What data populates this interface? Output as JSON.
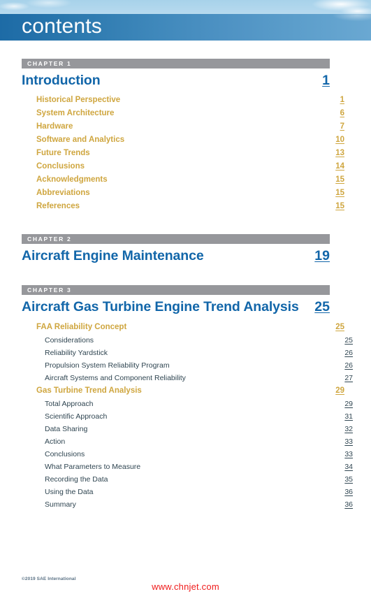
{
  "header": {
    "title": "contents",
    "banner_color": "#1d6ba6",
    "sky_color": "#bcdcf0"
  },
  "colors": {
    "chapter_title": "#1266a9",
    "chapter_bar": "#96979b",
    "level2": "#cfa63f",
    "level3": "#2f4551",
    "watermark": "#f01c1c"
  },
  "chapters": [
    {
      "bar_label": "CHAPTER 1",
      "title": "Introduction",
      "page": "1",
      "entries": [
        {
          "level": 2,
          "label": "Historical Perspective",
          "page": "1"
        },
        {
          "level": 2,
          "label": "System Architecture",
          "page": "6"
        },
        {
          "level": 2,
          "label": "Hardware",
          "page": "7"
        },
        {
          "level": 2,
          "label": "Software and Analytics",
          "page": "10"
        },
        {
          "level": 2,
          "label": "Future Trends",
          "page": "13"
        },
        {
          "level": 2,
          "label": "Conclusions",
          "page": "14"
        },
        {
          "level": 2,
          "label": "Acknowledgments",
          "page": "15"
        },
        {
          "level": 2,
          "label": "Abbreviations",
          "page": "15"
        },
        {
          "level": 2,
          "label": "References",
          "page": "15"
        }
      ]
    },
    {
      "bar_label": "CHAPTER 2",
      "title": "Aircraft Engine Maintenance",
      "page": "19",
      "entries": []
    },
    {
      "bar_label": "CHAPTER 3",
      "title": "Aircraft Gas Turbine Engine Trend Analysis",
      "page": "25",
      "entries": [
        {
          "level": 2,
          "label": "FAA Reliability Concept",
          "page": "25"
        },
        {
          "level": 3,
          "label": "Considerations",
          "page": "25"
        },
        {
          "level": 3,
          "label": "Reliability Yardstick",
          "page": "26"
        },
        {
          "level": 3,
          "label": "Propulsion System Reliability Program",
          "page": "26"
        },
        {
          "level": 3,
          "label": "Aircraft Systems and Component Reliability",
          "page": "27"
        },
        {
          "level": 2,
          "label": "Gas Turbine Trend Analysis",
          "page": "29"
        },
        {
          "level": 3,
          "label": "Total Approach",
          "page": "29"
        },
        {
          "level": 3,
          "label": "Scientific Approach",
          "page": "31"
        },
        {
          "level": 3,
          "label": "Data Sharing",
          "page": "32"
        },
        {
          "level": 3,
          "label": "Action",
          "page": "33"
        },
        {
          "level": 3,
          "label": "Conclusions",
          "page": "33"
        },
        {
          "level": 3,
          "label": "What Parameters to Measure",
          "page": "34"
        },
        {
          "level": 3,
          "label": "Recording the Data",
          "page": "35"
        },
        {
          "level": 3,
          "label": "Using the Data",
          "page": "36"
        },
        {
          "level": 3,
          "label": "Summary",
          "page": "36"
        }
      ]
    }
  ],
  "footer": {
    "copyright": "©2019 SAE International",
    "watermark": "www.chnjet.com"
  }
}
